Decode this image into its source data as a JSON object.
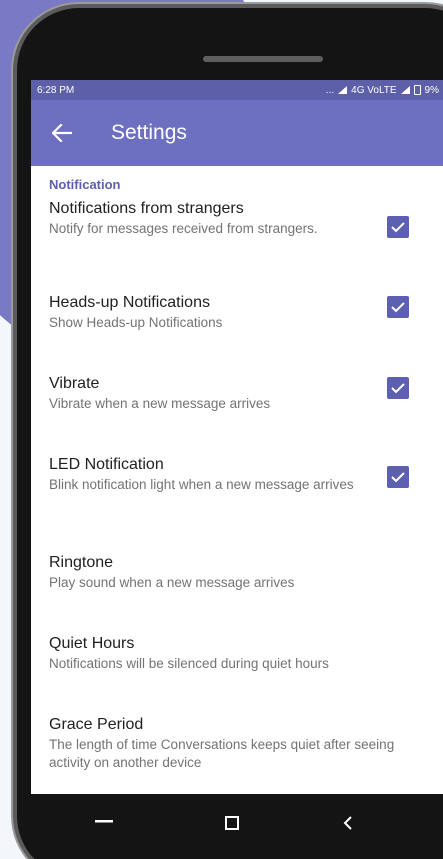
{
  "status_bar": {
    "time": "6:28 PM",
    "indicators": "... ",
    "network": "4G VoLTE",
    "battery": "9%"
  },
  "app_bar": {
    "back_icon": "arrow-left-icon",
    "title": "Settings"
  },
  "section": {
    "header": "Notification"
  },
  "preferences": [
    {
      "title": "Notifications from strangers",
      "summary": "Notify for messages received from strangers.",
      "checked": true
    },
    {
      "title": "Heads-up Notifications",
      "summary": "Show Heads-up Notifications",
      "checked": true
    },
    {
      "title": "Vibrate",
      "summary": "Vibrate when a new message arrives",
      "checked": true
    },
    {
      "title": "LED Notification",
      "summary": "Blink notification light when a new message arrives",
      "checked": true
    },
    {
      "title": "Ringtone",
      "summary": "Play sound when a new message arrives"
    },
    {
      "title": "Quiet Hours",
      "summary": "Notifications will be silenced during quiet hours"
    },
    {
      "title": "Grace Period",
      "summary": "The length of time Conversations keeps quiet after seeing activity on another device"
    }
  ],
  "nav_bar": {
    "menu_icon": "menu-icon",
    "home_icon": "square-home-icon",
    "back_icon": "chevron-left-icon"
  },
  "colors": {
    "accent": "#5d5fb0",
    "app_bar": "#6d6fc1",
    "status_bar": "#5d5fa8",
    "background_circle": "#7a79c6"
  }
}
